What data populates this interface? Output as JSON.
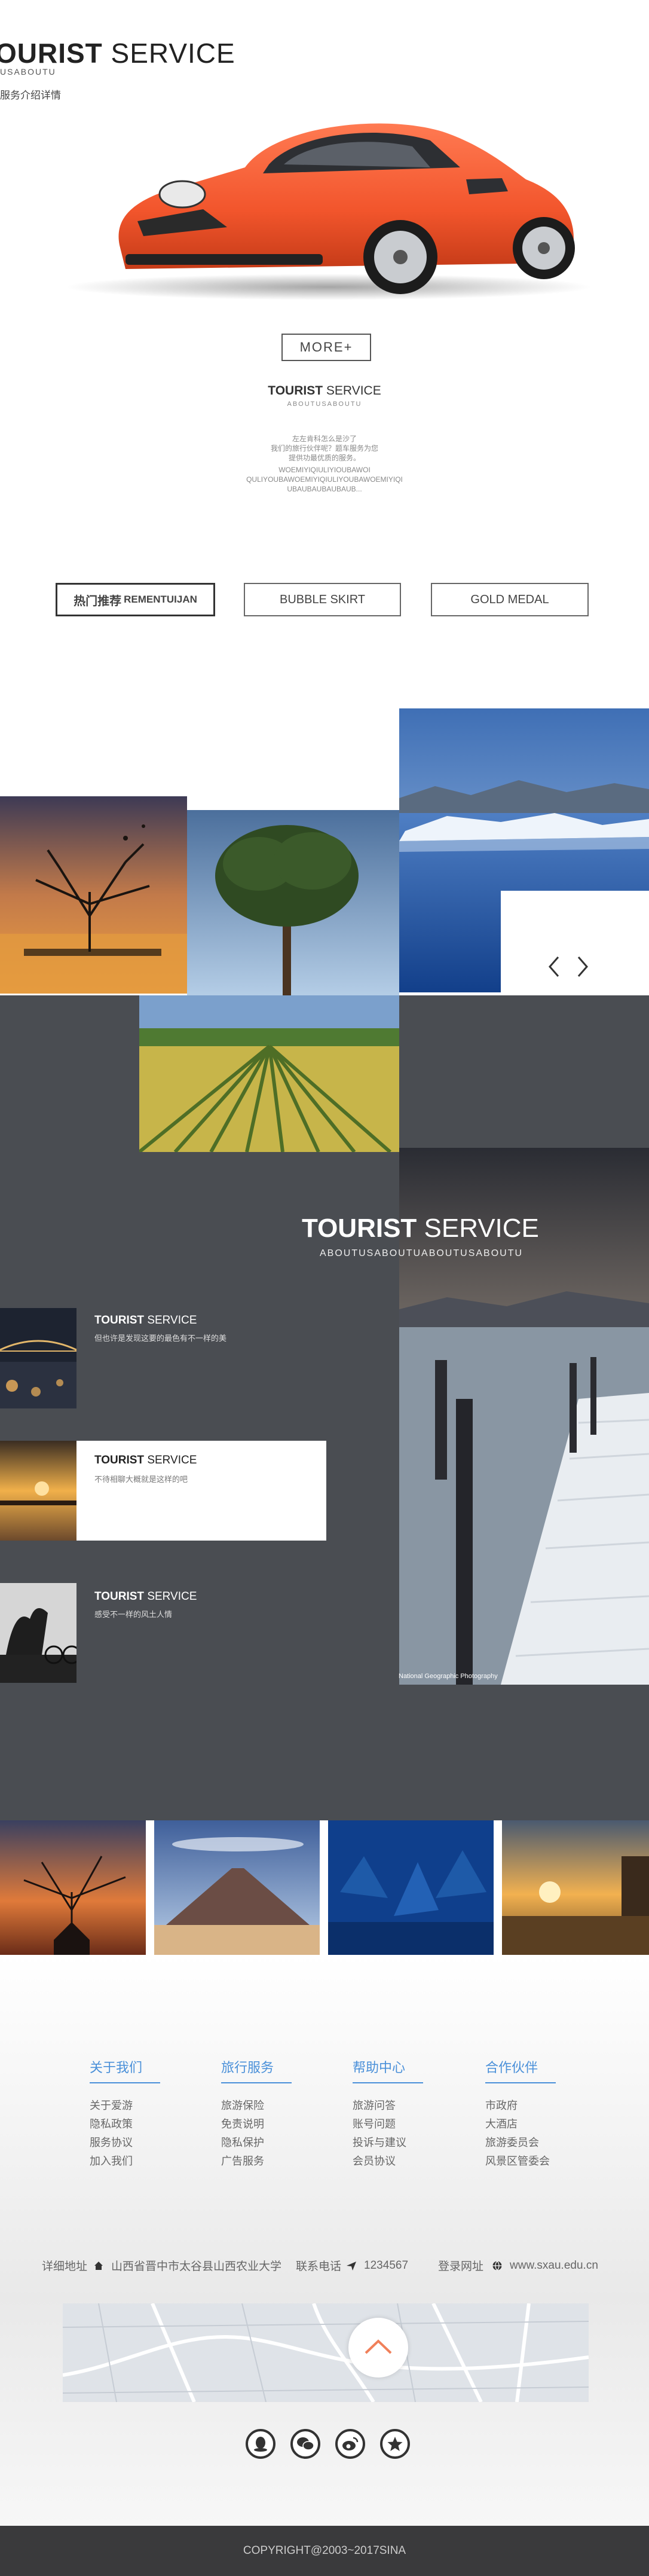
{
  "hero": {
    "title_bold": "OURIST",
    "title_light": " SERVICE",
    "subtitle": "USABOUTU",
    "description": "服务介绍详情",
    "more_label": "MORE+"
  },
  "about": {
    "title_bold": "TOURIST",
    "title_light": " SERVICE",
    "subtitle": "ABOUTUSABOUTU",
    "lines": [
      "左左肯科怎么是沙了",
      "我们的旅行伙伴呢？题车服务为您",
      "提供功最优质的服务。",
      "WOEMIYIQIULIYIOUBAWOI",
      "QULIYOUBAWOEMIYIQIULIYOUBAWOEMIYIQI",
      "UBAUBAUBAUBAUB..."
    ]
  },
  "tabs": [
    {
      "label": "热门推荐",
      "sub": "REMENTUIJAN",
      "active": true
    },
    {
      "label": "BUBBLE SKIRT",
      "sub": "",
      "active": false
    },
    {
      "label": "GOLD MEDAL",
      "sub": "",
      "active": false
    }
  ],
  "gallery": {
    "title_bold": "TOURIST",
    "title_light": " SERVICE",
    "subtitle": "ABOUTUSABOUTUABOUTUSABOUTU",
    "watermark": "National Geographic Photography",
    "items": [
      {
        "title_bold": "TOURIST",
        "title_light": " SERVICE",
        "desc": "但也许是发现这要的最色有不一样的美"
      },
      {
        "title_bold": "TOURIST",
        "title_light": " SERVICE",
        "desc": "不待相聊大概就是这样的吧"
      },
      {
        "title_bold": "TOURIST",
        "title_light": " SERVICE",
        "desc": "感受不一样的风土人情"
      }
    ]
  },
  "footer": {
    "columns": [
      {
        "title": "关于我们",
        "links": [
          "关于爱游",
          "隐私政策",
          "服务协议",
          "加入我们"
        ]
      },
      {
        "title": "旅行服务",
        "links": [
          "旅游保险",
          "免责说明",
          "隐私保护",
          "广告服务"
        ]
      },
      {
        "title": "帮助中心",
        "links": [
          "旅游问答",
          "账号问题",
          "投诉与建议",
          "会员协议"
        ]
      },
      {
        "title": "合作伙伴",
        "links": [
          "市政府",
          "大酒店",
          "旅游委员会",
          "风景区管委会"
        ]
      }
    ],
    "contact": {
      "address_label": "详细地址",
      "address": "山西省晋中市太谷县山西农业大学",
      "phone_label": "联系电话",
      "phone": "1234567",
      "site_label": "登录网址",
      "site": "www.sxau.edu.cn"
    },
    "copyright": "COPYRIGHT@2003~2017SINA"
  },
  "colors": {
    "accent": "#4a90d9",
    "gallery_bg": "#4a4d52",
    "car": "#f2552c",
    "footer_bar": "#3a3a3c"
  }
}
